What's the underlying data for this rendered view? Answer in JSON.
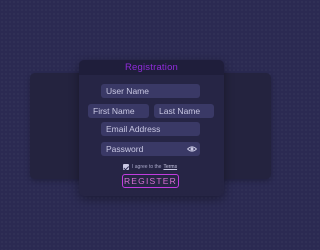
{
  "form": {
    "title": "Registration",
    "fields": {
      "username": {
        "placeholder": "User Name"
      },
      "first_name": {
        "placeholder": "First Name"
      },
      "last_name": {
        "placeholder": "Last Name"
      },
      "email": {
        "placeholder": "Email Address"
      },
      "password": {
        "placeholder": "Password",
        "icon": "eye-icon"
      }
    },
    "terms": {
      "checked": true,
      "text": "I agree to the",
      "link_label": "Terms"
    },
    "submit_label": "REGISTER"
  },
  "colors": {
    "background": "#2b2a52",
    "card": "#262545",
    "field": "#3a3966",
    "accent": "#8f2bd9",
    "button_border": "#c23ce0"
  }
}
